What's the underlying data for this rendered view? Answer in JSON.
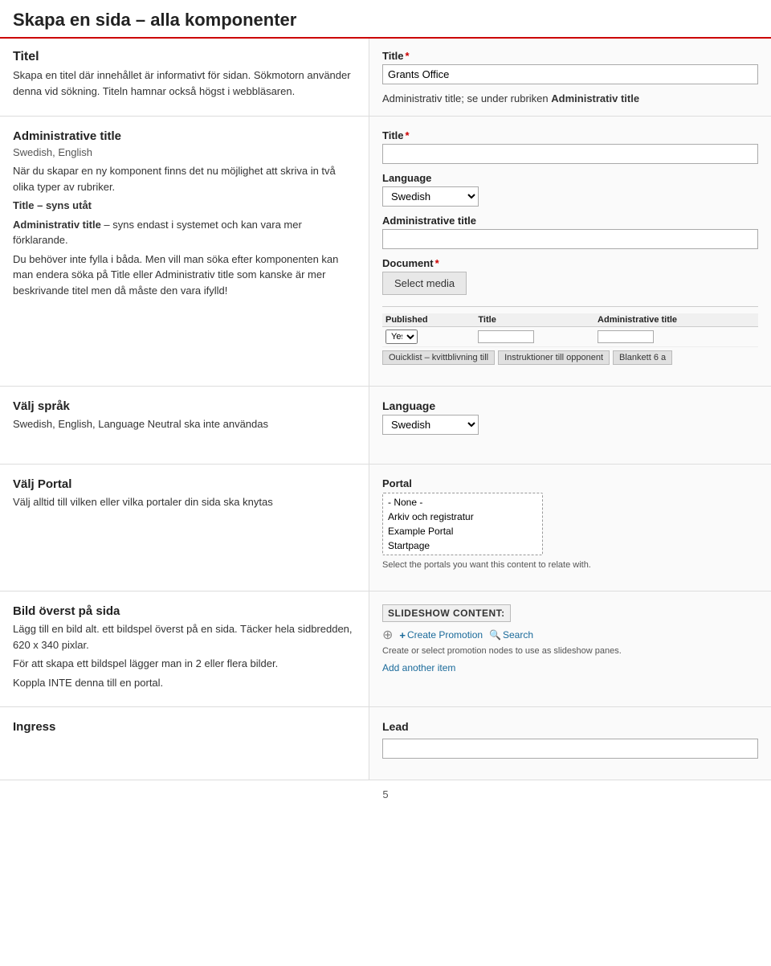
{
  "page": {
    "main_title": "Skapa en sida – alla komponenter",
    "footer_page_number": "5"
  },
  "section_titel": {
    "left": {
      "heading": "Titel",
      "body1": "Skapa en titel där innehållet är informativt för sidan. Sökmotorn använder denna vid sökning. Titeln hamnar också högst i webbläsaren."
    },
    "right": {
      "title_label": "Title",
      "title_value": "Grants Office",
      "note": "Administrativ title; se under rubriken ",
      "note_bold": "Administrativ title"
    }
  },
  "section_administrative": {
    "left": {
      "heading": "Administrative title",
      "subtitle": "Swedish, English",
      "body": "När du skapar en ny komponent finns det nu möjlighet att skriva in två olika typer av rubriker.",
      "body2": "Title – syns utåt",
      "body3": "Administrativ title – syns endast i systemet och kan vara mer förklarande.",
      "body4": "Du behöver inte fylla i båda. Men vill man söka efter komponenten kan man endera söka på Title eller Administrativ title som kanske är mer beskrivande titel men då måste den vara ifylld!"
    },
    "right": {
      "title_label": "Title",
      "language_label": "Language",
      "language_value": "Swedish",
      "admin_title_label": "Administrative title",
      "document_label": "Document",
      "select_media_label": "Select media",
      "table": {
        "col_published": "Published",
        "col_title": "Title",
        "col_admin_title": "Administrative title",
        "row_published": "Yes",
        "row_title": "",
        "row_admin_title": ""
      },
      "quicklinks": [
        "Ouicklist – kvittblivning till",
        "Instruktioner till opponent",
        "Blankett 6 a"
      ]
    }
  },
  "section_valj_sprak": {
    "left": {
      "heading": "Välj språk",
      "body": "Swedish, English, Language Neutral ska inte användas"
    },
    "right": {
      "language_label": "Language",
      "language_value": "Swedish"
    }
  },
  "section_valj_portal": {
    "left": {
      "heading": "Välj Portal",
      "body": "Välj alltid till vilken eller vilka portaler din sida ska knytas"
    },
    "right": {
      "portal_label": "Portal",
      "portal_options": [
        "- None -",
        "Arkiv och registratur",
        "Example Portal",
        "Startpage"
      ],
      "portal_note": "Select the portals you want this content to relate with."
    }
  },
  "section_bild": {
    "left": {
      "heading": "Bild överst på sida",
      "body1": "Lägg till en bild alt. ett bildspel överst på en sida. Täcker hela sidbredden, 620 x 340 pixlar.",
      "body2": "För att skapa ett bildspel lägger man in 2 eller flera bilder.",
      "body3": "Koppla INTE denna till en portal."
    },
    "right": {
      "slideshow_header": "SLIDESHOW CONTENT:",
      "create_promotion_label": "Create Promotion",
      "search_label": "Search",
      "slideshow_note": "Create or select promotion nodes to use as slideshow panes.",
      "add_item_label": "Add another item"
    }
  },
  "section_ingress": {
    "left": {
      "heading": "Ingress"
    },
    "right": {
      "lead_label": "Lead"
    }
  }
}
